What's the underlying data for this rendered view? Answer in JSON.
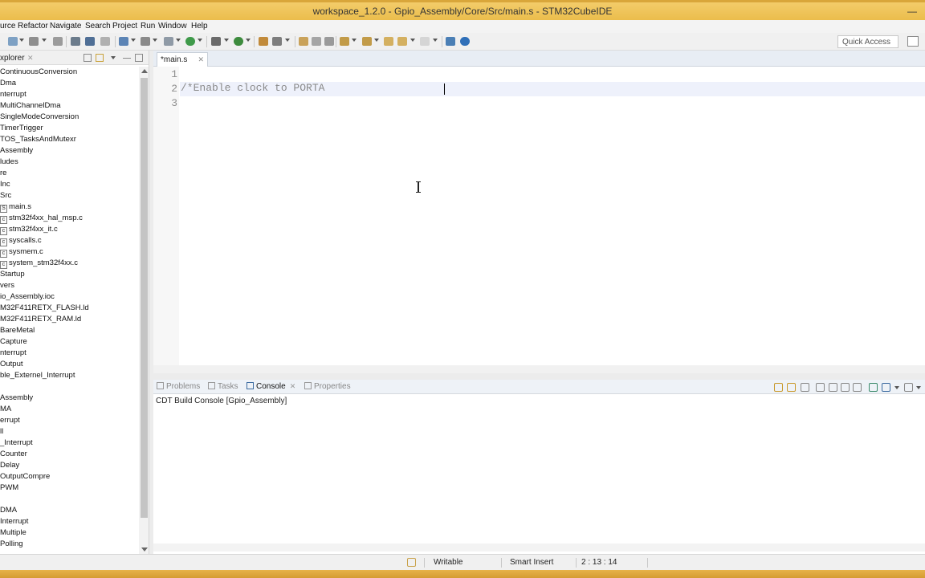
{
  "window": {
    "title": "workspace_1.2.0 - Gpio_Assembly/Core/Src/main.s - STM32CubeIDE",
    "minimize_glyph": "—"
  },
  "menu": [
    "urce",
    "Refactor",
    "Navigate",
    "Search",
    "Project",
    "Run",
    "Window",
    "Help"
  ],
  "toolbar": {
    "quick_access_placeholder": "Quick Access"
  },
  "explorer": {
    "title": "xplorer",
    "close_glyph": "✕",
    "items": [
      "ContinuousConversion",
      "Dma",
      "nterrupt",
      "MultiChannelDma",
      "SingleModeConversion",
      "TimerTrigger",
      "TOS_TasksAndMutexr",
      "Assembly",
      "ludes",
      "re",
      "Inc",
      "Src",
      "main.s",
      "stm32f4xx_hal_msp.c",
      "stm32f4xx_it.c",
      "syscalls.c",
      "sysmem.c",
      "system_stm32f4xx.c",
      "Startup",
      "vers",
      "io_Assembly.ioc",
      "M32F411RETX_FLASH.ld",
      "M32F411RETX_RAM.ld",
      "BareMetal",
      "Capture",
      "nterrupt",
      "Output",
      "ble_Externel_Interrupt",
      "Assembly",
      "MA",
      "errupt",
      "ll",
      "_Interrupt",
      "Counter",
      "Delay",
      "OutputCompre",
      "PWM",
      "DMA",
      "Interrupt",
      "Multiple",
      "Polling"
    ],
    "file_icon_labels": [
      "S",
      "c",
      "c",
      "c",
      "c",
      "c"
    ]
  },
  "editor": {
    "tab_label": "*main.s",
    "close_glyph": "✕",
    "line_numbers": [
      "1",
      "2",
      "3"
    ],
    "lines": [
      "",
      "/*Enable clock to PORTA",
      ""
    ]
  },
  "bottom_panel": {
    "tabs": [
      "Problems",
      "Tasks",
      "Console",
      "Properties"
    ],
    "active_tab": "Console",
    "close_glyph": "✕",
    "console_title": "CDT Build Console [Gpio_Assembly]"
  },
  "status": {
    "mode": "Writable",
    "insert": "Smart Insert",
    "position": "2 : 13 : 14"
  }
}
